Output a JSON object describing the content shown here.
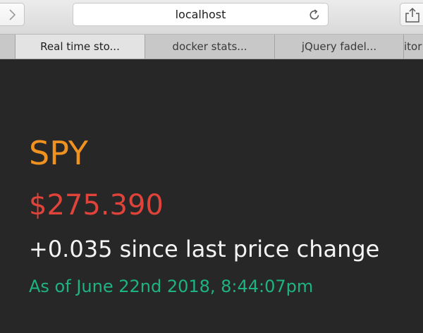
{
  "browser": {
    "address": "localhost",
    "tabs": [
      {
        "label": "Real time sto...",
        "active": true
      },
      {
        "label": "docker stats...",
        "active": false
      },
      {
        "label": "jQuery fadel...",
        "active": false
      },
      {
        "label": "itor",
        "active": false
      }
    ],
    "icons": {
      "forward": "chevron-right-icon",
      "reload": "reload-icon",
      "share": "share-icon"
    }
  },
  "quote": {
    "symbol": "SPY",
    "price": "$275.390",
    "change": "+0.035 since last price change",
    "timestamp": "As of June 22nd 2018, 8:44:07pm"
  },
  "colors": {
    "background": "#272727",
    "symbol": "#ef9220",
    "price": "#e0433a",
    "change": "#f4f4f4",
    "timestamp": "#1db383"
  }
}
